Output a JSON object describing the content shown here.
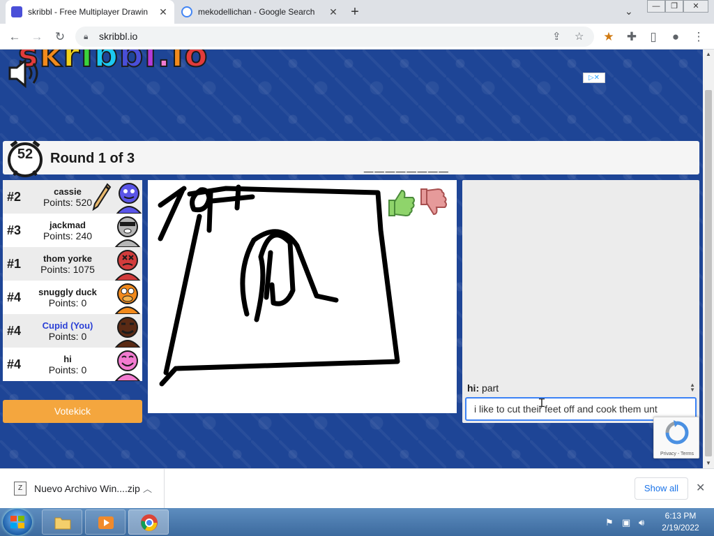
{
  "browser": {
    "tabs": [
      {
        "title": "skribbl - Free Multiplayer Drawin",
        "active": true,
        "favicon_color": "#4a4fd8"
      },
      {
        "title": "mekodellichan - Google Search",
        "active": false,
        "favicon_color": "#4285f4"
      }
    ],
    "new_tab_label": "+",
    "url": "skribbl.io",
    "window_controls": [
      "—",
      "❐",
      "✕"
    ]
  },
  "game": {
    "logo_text": "skribbl.io",
    "timer": "52",
    "round_text": "Round 1 of 3",
    "word_hint": "________",
    "players": [
      {
        "rank": "#2",
        "name": "cassie",
        "points": "Points: 520",
        "avatar_color": "#5a55e8",
        "drawing": true
      },
      {
        "rank": "#3",
        "name": "jackmad",
        "points": "Points: 240",
        "avatar_color": "#b6b6b6",
        "drawing": false
      },
      {
        "rank": "#1",
        "name": "thom yorke",
        "points": "Points: 1075",
        "avatar_color": "#d23c3c",
        "drawing": false
      },
      {
        "rank": "#4",
        "name": "snuggly duck",
        "points": "Points: 0",
        "avatar_color": "#f28a1c",
        "drawing": false
      },
      {
        "rank": "#4",
        "name": "Cupid (You)",
        "points": "Points: 0",
        "avatar_color": "#5a2a14",
        "drawing": false,
        "is_you": true
      },
      {
        "rank": "#4",
        "name": "hi",
        "points": "Points: 0",
        "avatar_color": "#f27bd0",
        "drawing": false
      }
    ],
    "speech_bubble": "part",
    "votekick_label": "Votekick",
    "chat": {
      "messages": [
        {
          "author": "hi:",
          "text": "part"
        }
      ],
      "input_value": "i like to cut their feet off and cook them unt"
    },
    "recaptcha_text": "Privacy - Terms",
    "colors": {
      "background": "#1e4596",
      "votekick": "#f4a63e",
      "you_name": "#2b40d6"
    }
  },
  "downloads": {
    "file_name": "Nuevo Archivo Win....zip",
    "show_all_label": "Show all"
  },
  "taskbar": {
    "time": "6:13 PM",
    "date": "2/19/2022"
  }
}
